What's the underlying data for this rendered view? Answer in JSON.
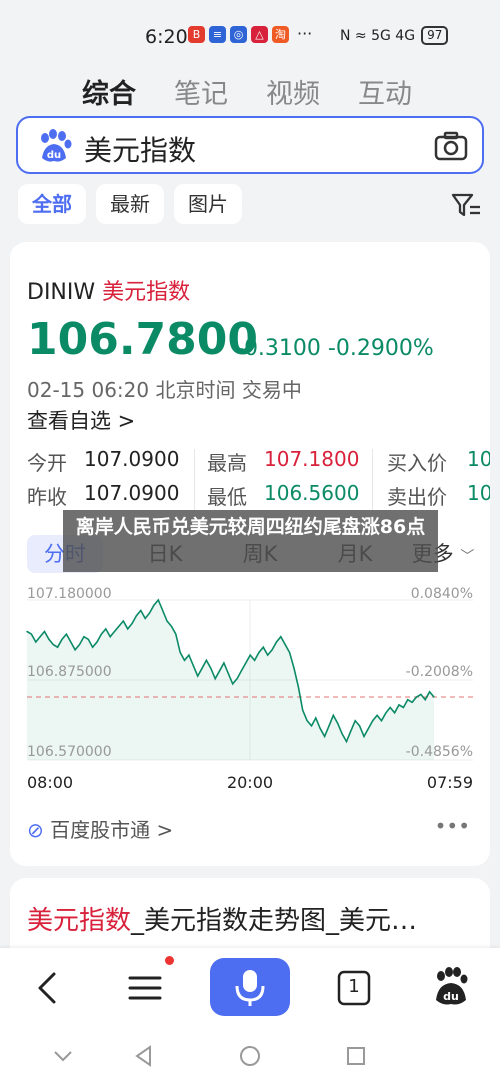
{
  "status_bar": {
    "time": "6:20",
    "app_icons": [
      {
        "label": "B",
        "color": "#e33b2e"
      },
      {
        "label": "≡",
        "color": "#2f64d6"
      },
      {
        "label": "◎",
        "color": "#2f64d6"
      },
      {
        "label": "△",
        "color": "#d8213b"
      },
      {
        "label": "淘",
        "color": "#f05a24"
      }
    ],
    "dots": "···",
    "signal_text": "N  ≈  5G  4G",
    "battery": "97"
  },
  "top_tabs": [
    {
      "label": "综合",
      "active": true
    },
    {
      "label": "笔记",
      "active": false
    },
    {
      "label": "视频",
      "active": false
    },
    {
      "label": "互动",
      "active": false
    }
  ],
  "search": {
    "query": "美元指数"
  },
  "filters": [
    {
      "label": "全部",
      "active": true
    },
    {
      "label": "最新",
      "active": false
    },
    {
      "label": "图片",
      "active": false
    }
  ],
  "quote": {
    "code": "DINIW",
    "name": "美元指数",
    "price": "106.7800",
    "change": "-0.3100",
    "change_pct": "-0.2900%",
    "time": "02-15 06:20 北京时间 交易中",
    "watch_label": "查看自选 >",
    "stats": {
      "open_label": "今开",
      "open": "107.0900",
      "high_label": "最高",
      "high": "107.1800",
      "bid_label": "买入价",
      "bid": "10",
      "prev_label": "昨收",
      "prev": "107.0900",
      "low_label": "最低",
      "low": "106.5600",
      "ask_label": "卖出价",
      "ask": "10"
    },
    "chart_tabs": [
      "分时",
      "日K",
      "周K",
      "月K",
      "更多"
    ],
    "source": "百度股市通 >",
    "more": "•••"
  },
  "overlay_caption": "离岸人民币兑美元较周四纽约尾盘涨86点",
  "chart_data": {
    "type": "line",
    "title": "",
    "y_ticks_left": [
      "107.180000",
      "106.875000",
      "106.570000"
    ],
    "y_ticks_right": [
      "0.0840%",
      "-0.2008%",
      "-0.4856%"
    ],
    "x_ticks": [
      "08:00",
      "20:00",
      "07:59"
    ],
    "ylim": [
      106.57,
      107.18
    ],
    "prev_close": 106.81,
    "series": [
      {
        "values": [
          107.06,
          107.05,
          107.02,
          107.04,
          107.06,
          107.03,
          107.01,
          107.0,
          107.03,
          107.05,
          107.02,
          106.99,
          107.01,
          107.04,
          107.03,
          107.0,
          107.02,
          107.05,
          107.07,
          107.04,
          107.06,
          107.08,
          107.1,
          107.07,
          107.09,
          107.12,
          107.14,
          107.11,
          107.13,
          107.16,
          107.18,
          107.14,
          107.1,
          107.08,
          107.05,
          106.98,
          106.95,
          106.97,
          106.93,
          106.89,
          106.92,
          106.95,
          106.92,
          106.88,
          106.91,
          106.94,
          106.9,
          106.86,
          106.88,
          106.91,
          106.94,
          106.97,
          106.95,
          106.98,
          107.0,
          106.97,
          106.99,
          107.02,
          107.04,
          107.01,
          106.98,
          106.92,
          106.85,
          106.76,
          106.72,
          106.7,
          106.73,
          106.69,
          106.66,
          106.7,
          106.74,
          106.71,
          106.67,
          106.64,
          106.68,
          106.72,
          106.7,
          106.66,
          106.69,
          106.72,
          106.74,
          106.72,
          106.75,
          106.77,
          106.75,
          106.78,
          106.77,
          106.8,
          106.79,
          106.81,
          106.82,
          106.8,
          106.83,
          106.81
        ]
      }
    ]
  },
  "card2": {
    "title_red": "美元指数",
    "title_rest": "_美元指数走势图_美元…"
  },
  "bottom_bar": {
    "tab_count": "1"
  },
  "colors": {
    "accent": "#4e6ef2",
    "up": "#d8213b",
    "down": "#0b8a66"
  }
}
